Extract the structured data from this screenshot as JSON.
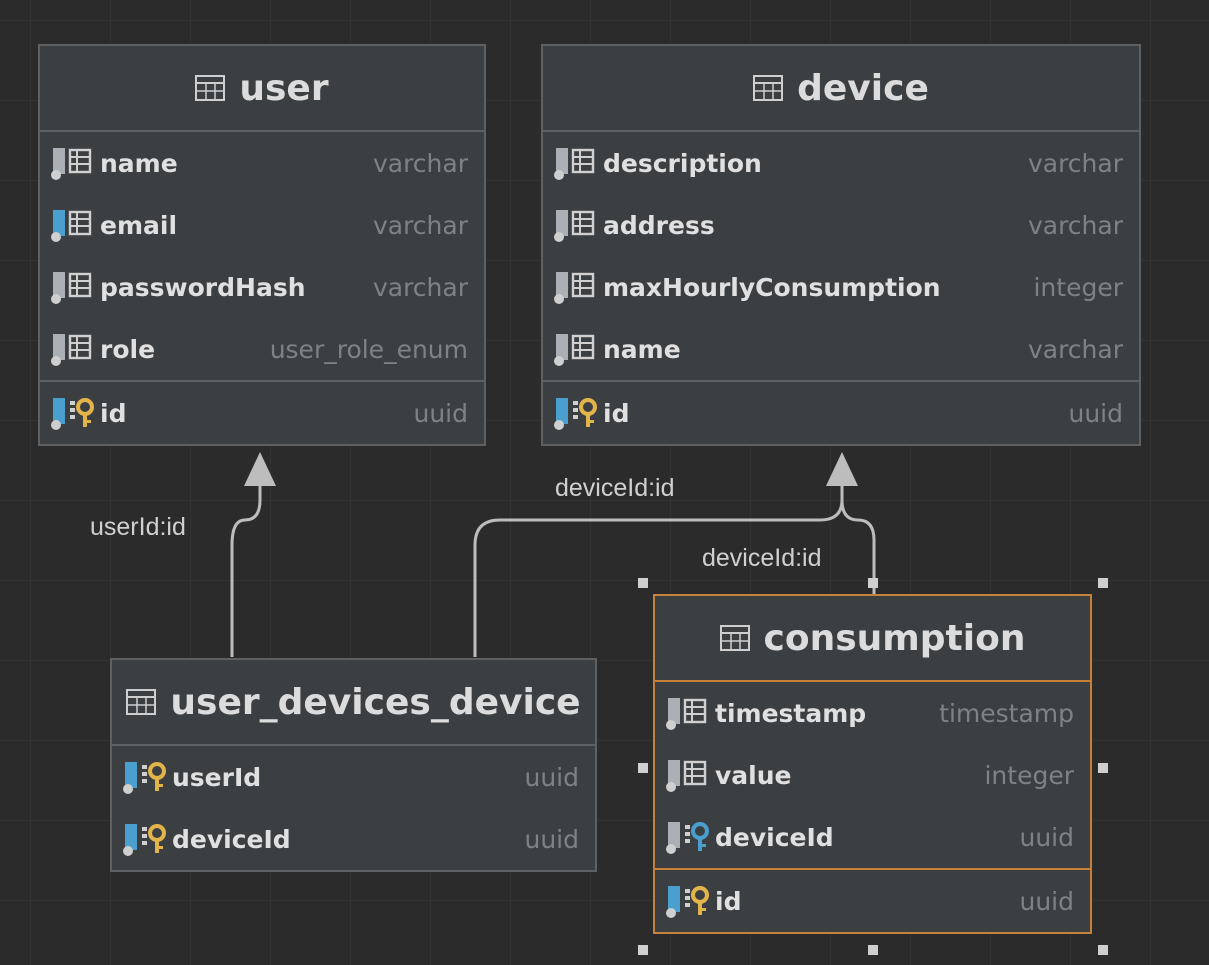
{
  "tables": {
    "user": {
      "title": "user",
      "columns": [
        {
          "name": "name",
          "type": "varchar",
          "kind": "column"
        },
        {
          "name": "email",
          "type": "varchar",
          "kind": "indexed-column"
        },
        {
          "name": "passwordHash",
          "type": "varchar",
          "kind": "column"
        },
        {
          "name": "role",
          "type": "user_role_enum",
          "kind": "column"
        }
      ],
      "keys": [
        {
          "name": "id",
          "type": "uuid",
          "kind": "primary-key"
        }
      ]
    },
    "device": {
      "title": "device",
      "columns": [
        {
          "name": "description",
          "type": "varchar",
          "kind": "column"
        },
        {
          "name": "address",
          "type": "varchar",
          "kind": "column"
        },
        {
          "name": "maxHourlyConsumption",
          "type": "integer",
          "kind": "column"
        },
        {
          "name": "name",
          "type": "varchar",
          "kind": "column"
        }
      ],
      "keys": [
        {
          "name": "id",
          "type": "uuid",
          "kind": "primary-key"
        }
      ]
    },
    "user_devices_device": {
      "title": "user_devices_device",
      "columns": [
        {
          "name": "userId",
          "type": "uuid",
          "kind": "primary-key"
        },
        {
          "name": "deviceId",
          "type": "uuid",
          "kind": "primary-key"
        }
      ]
    },
    "consumption": {
      "title": "consumption",
      "columns": [
        {
          "name": "timestamp",
          "type": "timestamp",
          "kind": "column"
        },
        {
          "name": "value",
          "type": "integer",
          "kind": "column"
        },
        {
          "name": "deviceId",
          "type": "uuid",
          "kind": "foreign-key"
        }
      ],
      "keys": [
        {
          "name": "id",
          "type": "uuid",
          "kind": "primary-key"
        }
      ]
    }
  },
  "relations": [
    {
      "label": "userId:id",
      "from": "user_devices_device",
      "to": "user"
    },
    {
      "label": "deviceId:id",
      "from": "user_devices_device",
      "to": "device"
    },
    {
      "label": "deviceId:id",
      "from": "consumption",
      "to": "device"
    }
  ],
  "colors": {
    "background": "#2b2b2b",
    "table_fill": "#3c3f41",
    "table_border": "#5e6062",
    "selected_border": "#c6803a",
    "line": "#bdbdbd",
    "key_icon": "#e3b44a",
    "index_icon": "#4a9fcf"
  }
}
